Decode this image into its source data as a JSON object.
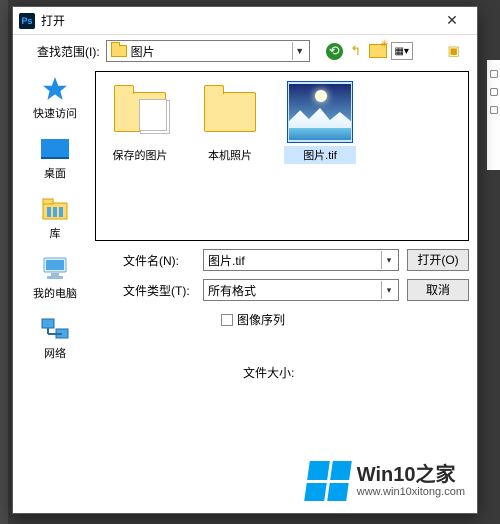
{
  "dialog": {
    "title": "打开",
    "range_label": "查找范围(I):",
    "range_value": "图片",
    "nav": {
      "back": "back-icon",
      "up": "up-one-level-icon",
      "new_folder": "new-folder-icon",
      "views": "views-icon",
      "last": "thumb-icon"
    },
    "sidebar": [
      {
        "id": "quick",
        "label": "快速访问"
      },
      {
        "id": "desktop",
        "label": "桌面"
      },
      {
        "id": "lib",
        "label": "库"
      },
      {
        "id": "pc",
        "label": "我的电脑"
      },
      {
        "id": "net",
        "label": "网络"
      }
    ],
    "files": [
      {
        "id": "saved",
        "label": "保存的图片",
        "type": "folder-pics",
        "selected": false
      },
      {
        "id": "native",
        "label": "本机照片",
        "type": "folder",
        "selected": false
      },
      {
        "id": "tif",
        "label": "图片.tif",
        "type": "image",
        "selected": true
      }
    ],
    "filename_label": "文件名(N):",
    "filename_value": "图片.tif",
    "filetype_label": "文件类型(T):",
    "filetype_value": "所有格式",
    "open_button": "打开(O)",
    "cancel_button": "取消",
    "sequence_checkbox": "图像序列",
    "filesize_label": "文件大小:"
  },
  "watermark": {
    "title": "Win10之家",
    "url": "www.win10xitong.com"
  }
}
